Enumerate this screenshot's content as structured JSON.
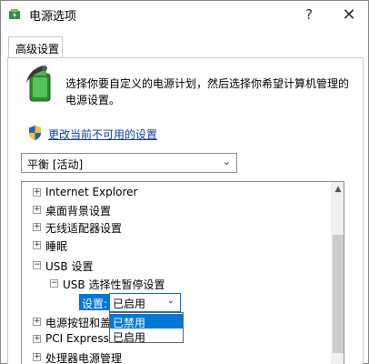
{
  "window": {
    "title": "电源选项",
    "help_label": "?",
    "close_label": "✕"
  },
  "tabs": [
    {
      "label": "高级设置"
    }
  ],
  "description": "选择你要自定义的电源计划，然后选择你希望计算机管理的电源设置。",
  "change_link": "更改当前不可用的设置",
  "plan_select": {
    "value": "平衡 [活动]"
  },
  "tree": {
    "items": [
      {
        "label": "Internet Explorer",
        "expander": "+"
      },
      {
        "label": "桌面背景设置",
        "expander": "+"
      },
      {
        "label": "无线适配器设置",
        "expander": "+"
      },
      {
        "label": "睡眠",
        "expander": "+"
      },
      {
        "label": "USB 设置",
        "expander": "−"
      },
      {
        "label": "USB 选择性暂停设置",
        "expander": "−"
      },
      {
        "label": "电源按钮和盖",
        "expander": "+"
      },
      {
        "label": "PCI Express",
        "expander": "+"
      },
      {
        "label": "处理器电源管理",
        "expander": "+"
      }
    ],
    "setting_label": "设置:",
    "dropdown": {
      "value": "已启用",
      "options": [
        {
          "label": "已禁用",
          "selected": true
        },
        {
          "label": "已启用",
          "selected": false
        }
      ]
    }
  },
  "icons": {
    "app": "power-options-icon",
    "battery": "battery-power-icon",
    "shield": "uac-shield-icon"
  },
  "colors": {
    "accent": "#0078d7",
    "link": "#0b3fa8"
  }
}
